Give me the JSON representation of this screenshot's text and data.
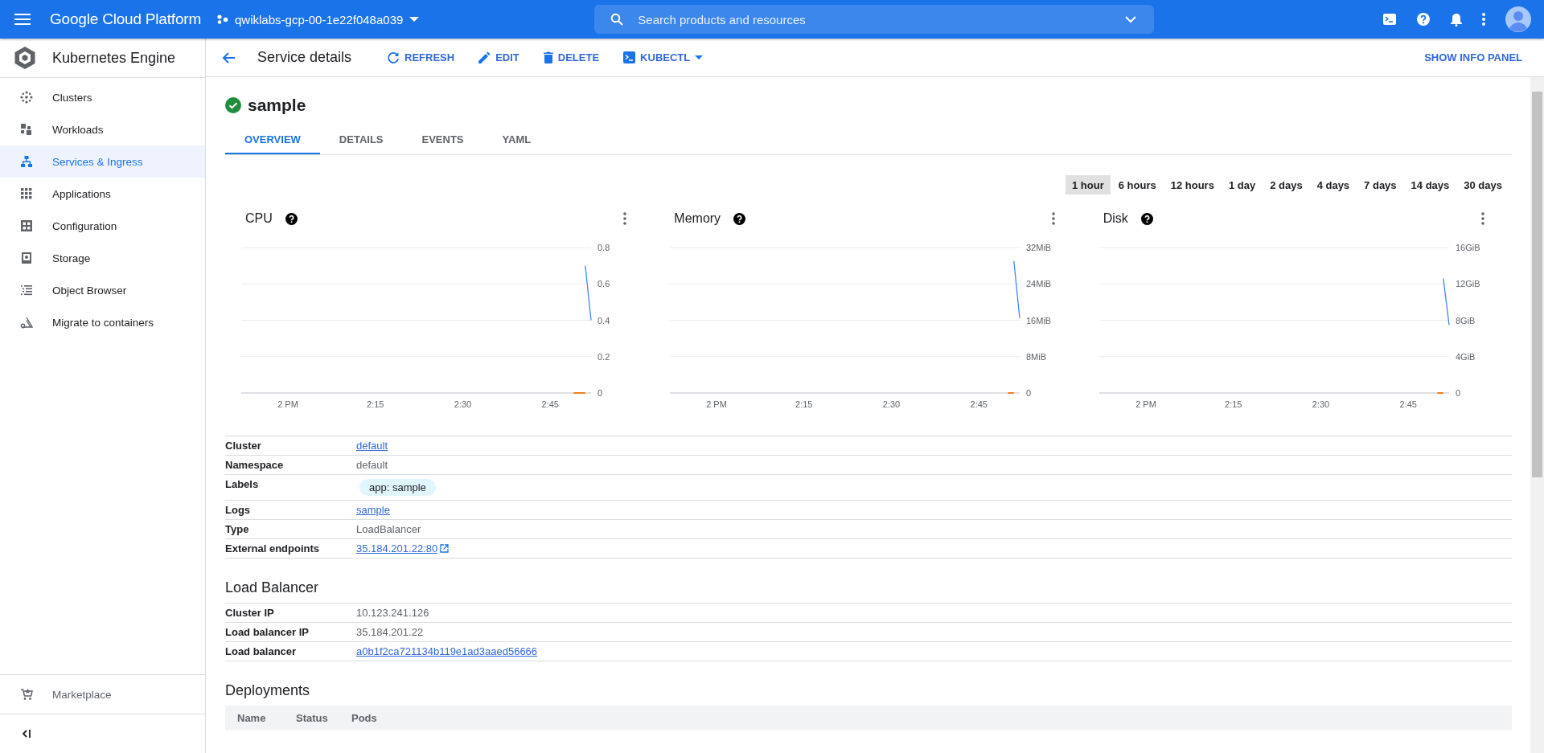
{
  "topbar": {
    "product": "Google Cloud Platform",
    "project": "qwiklabs-gcp-00-1e22f048a039",
    "search": {
      "placeholder": "Search products and resources"
    }
  },
  "sidebar": {
    "title": "Kubernetes Engine",
    "items": [
      {
        "label": "Clusters",
        "kind": "clusters",
        "selected": false
      },
      {
        "label": "Workloads",
        "kind": "workloads",
        "selected": false
      },
      {
        "label": "Services & Ingress",
        "kind": "services",
        "selected": true
      },
      {
        "label": "Applications",
        "kind": "applications",
        "selected": false
      },
      {
        "label": "Configuration",
        "kind": "configuration",
        "selected": false
      },
      {
        "label": "Storage",
        "kind": "storage",
        "selected": false
      },
      {
        "label": "Object Browser",
        "kind": "browser",
        "selected": false
      },
      {
        "label": "Migrate to containers",
        "kind": "migrate",
        "selected": false
      }
    ],
    "footer": {
      "label": "Marketplace"
    }
  },
  "header": {
    "title": "Service details",
    "actions": [
      {
        "label": "REFRESH",
        "kind": "refresh"
      },
      {
        "label": "EDIT",
        "kind": "edit"
      },
      {
        "label": "DELETE",
        "kind": "delete"
      },
      {
        "label": "KUBECTL",
        "kind": "kubectl"
      }
    ],
    "info_panel": "SHOW INFO PANEL"
  },
  "service": {
    "name": "sample",
    "healthy": true
  },
  "tabs": [
    {
      "label": "OVERVIEW",
      "selected": true
    },
    {
      "label": "DETAILS",
      "selected": false
    },
    {
      "label": "EVENTS",
      "selected": false
    },
    {
      "label": "YAML",
      "selected": false
    }
  ],
  "time_ranges": [
    {
      "label": "1 hour",
      "selected": true
    },
    {
      "label": "6 hours",
      "selected": false
    },
    {
      "label": "12 hours",
      "selected": false
    },
    {
      "label": "1 day",
      "selected": false
    },
    {
      "label": "2 days",
      "selected": false
    },
    {
      "label": "4 days",
      "selected": false
    },
    {
      "label": "7 days",
      "selected": false
    },
    {
      "label": "14 days",
      "selected": false
    },
    {
      "label": "30 days",
      "selected": false
    }
  ],
  "charts": [
    {
      "title": "CPU",
      "chart_data": {
        "type": "line",
        "grid": true,
        "categories": [
          null,
          null,
          null,
          null,
          null,
          null,
          null,
          null,
          "2 PM",
          null,
          null,
          null,
          null,
          null,
          null,
          null,
          null,
          null,
          null,
          null,
          null,
          null,
          null,
          "2:15",
          null,
          null,
          null,
          null,
          null,
          null,
          null,
          null,
          null,
          null,
          null,
          null,
          null,
          null,
          "2:30",
          null,
          null,
          null,
          null,
          null,
          null,
          null,
          null,
          null,
          null,
          null,
          null,
          null,
          null,
          "2:45",
          null,
          null,
          null,
          null,
          null,
          null,
          null
        ],
        "ylim": [
          0,
          0.8
        ],
        "yticks": [
          0,
          0.2,
          0.4,
          0.6,
          0.8
        ],
        "series": [
          {
            "color": "#4285f4",
            "values": [
              null,
              null,
              null,
              null,
              null,
              null,
              null,
              null,
              null,
              null,
              null,
              null,
              null,
              null,
              null,
              null,
              null,
              null,
              null,
              null,
              null,
              null,
              null,
              null,
              null,
              null,
              null,
              null,
              null,
              null,
              null,
              null,
              null,
              null,
              null,
              null,
              null,
              null,
              null,
              null,
              null,
              null,
              null,
              null,
              null,
              null,
              null,
              null,
              null,
              null,
              null,
              null,
              null,
              null,
              null,
              null,
              null,
              null,
              null,
              0.7,
              0.4
            ]
          },
          {
            "color": "#fa7b17",
            "values": [
              null,
              null,
              null,
              null,
              null,
              null,
              null,
              null,
              null,
              null,
              null,
              null,
              null,
              null,
              null,
              null,
              null,
              null,
              null,
              null,
              null,
              null,
              null,
              null,
              null,
              null,
              null,
              null,
              null,
              null,
              null,
              null,
              null,
              null,
              null,
              null,
              null,
              null,
              null,
              null,
              null,
              null,
              null,
              null,
              null,
              null,
              null,
              null,
              null,
              null,
              null,
              null,
              null,
              null,
              null,
              null,
              null,
              0,
              0,
              0,
              null
            ]
          }
        ]
      }
    },
    {
      "title": "Memory",
      "chart_data": {
        "type": "line",
        "grid": true,
        "categories": [
          null,
          null,
          null,
          null,
          null,
          null,
          null,
          null,
          "2 PM",
          null,
          null,
          null,
          null,
          null,
          null,
          null,
          null,
          null,
          null,
          null,
          null,
          null,
          null,
          "2:15",
          null,
          null,
          null,
          null,
          null,
          null,
          null,
          null,
          null,
          null,
          null,
          null,
          null,
          null,
          "2:30",
          null,
          null,
          null,
          null,
          null,
          null,
          null,
          null,
          null,
          null,
          null,
          null,
          null,
          null,
          "2:45",
          null,
          null,
          null,
          null,
          null,
          null,
          null
        ],
        "ylim": [
          0,
          32
        ],
        "yticks": [
          {
            "value": 0,
            "label": "0"
          },
          {
            "value": 8,
            "label": "8MiB"
          },
          {
            "value": 16,
            "label": "16MiB"
          },
          {
            "value": 24,
            "label": "24MiB"
          },
          {
            "value": 32,
            "label": "32MiB"
          }
        ],
        "series": [
          {
            "color": "#4285f4",
            "values": [
              null,
              null,
              null,
              null,
              null,
              null,
              null,
              null,
              null,
              null,
              null,
              null,
              null,
              null,
              null,
              null,
              null,
              null,
              null,
              null,
              null,
              null,
              null,
              null,
              null,
              null,
              null,
              null,
              null,
              null,
              null,
              null,
              null,
              null,
              null,
              null,
              null,
              null,
              null,
              null,
              null,
              null,
              null,
              null,
              null,
              null,
              null,
              null,
              null,
              null,
              null,
              null,
              null,
              null,
              null,
              null,
              null,
              null,
              null,
              29,
              16.5
            ]
          },
          {
            "color": "#fa7b17",
            "values": [
              null,
              null,
              null,
              null,
              null,
              null,
              null,
              null,
              null,
              null,
              null,
              null,
              null,
              null,
              null,
              null,
              null,
              null,
              null,
              null,
              null,
              null,
              null,
              null,
              null,
              null,
              null,
              null,
              null,
              null,
              null,
              null,
              null,
              null,
              null,
              null,
              null,
              null,
              null,
              null,
              null,
              null,
              null,
              null,
              null,
              null,
              null,
              null,
              null,
              null,
              null,
              null,
              null,
              null,
              null,
              null,
              null,
              null,
              0,
              0,
              null
            ]
          }
        ]
      }
    },
    {
      "title": "Disk",
      "chart_data": {
        "type": "line",
        "grid": true,
        "categories": [
          null,
          null,
          null,
          null,
          null,
          null,
          null,
          null,
          "2 PM",
          null,
          null,
          null,
          null,
          null,
          null,
          null,
          null,
          null,
          null,
          null,
          null,
          null,
          null,
          "2:15",
          null,
          null,
          null,
          null,
          null,
          null,
          null,
          null,
          null,
          null,
          null,
          null,
          null,
          null,
          "2:30",
          null,
          null,
          null,
          null,
          null,
          null,
          null,
          null,
          null,
          null,
          null,
          null,
          null,
          null,
          "2:45",
          null,
          null,
          null,
          null,
          null,
          null,
          null
        ],
        "ylim": [
          0,
          16
        ],
        "yticks": [
          {
            "value": 0,
            "label": "0"
          },
          {
            "value": 4,
            "label": "4GiB"
          },
          {
            "value": 8,
            "label": "8GiB"
          },
          {
            "value": 12,
            "label": "12GiB"
          },
          {
            "value": 16,
            "label": "16GiB"
          }
        ],
        "series": [
          {
            "color": "#4285f4",
            "values": [
              null,
              null,
              null,
              null,
              null,
              null,
              null,
              null,
              null,
              null,
              null,
              null,
              null,
              null,
              null,
              null,
              null,
              null,
              null,
              null,
              null,
              null,
              null,
              null,
              null,
              null,
              null,
              null,
              null,
              null,
              null,
              null,
              null,
              null,
              null,
              null,
              null,
              null,
              null,
              null,
              null,
              null,
              null,
              null,
              null,
              null,
              null,
              null,
              null,
              null,
              null,
              null,
              null,
              null,
              null,
              null,
              null,
              null,
              null,
              12.6,
              7.5
            ]
          },
          {
            "color": "#fa7b17",
            "values": [
              null,
              null,
              null,
              null,
              null,
              null,
              null,
              null,
              null,
              null,
              null,
              null,
              null,
              null,
              null,
              null,
              null,
              null,
              null,
              null,
              null,
              null,
              null,
              null,
              null,
              null,
              null,
              null,
              null,
              null,
              null,
              null,
              null,
              null,
              null,
              null,
              null,
              null,
              null,
              null,
              null,
              null,
              null,
              null,
              null,
              null,
              null,
              null,
              null,
              null,
              null,
              null,
              null,
              null,
              null,
              null,
              null,
              null,
              0,
              0,
              null
            ]
          }
        ]
      }
    }
  ],
  "details": [
    {
      "label": "Cluster",
      "value": "default",
      "kind": "link"
    },
    {
      "label": "Namespace",
      "value": "default",
      "kind": "text"
    },
    {
      "label": "Labels",
      "value": "app: sample",
      "kind": "chip"
    },
    {
      "label": "Logs",
      "value": "sample",
      "kind": "link"
    },
    {
      "label": "Type",
      "value": "LoadBalancer",
      "kind": "text"
    },
    {
      "label": "External endpoints",
      "value": "35.184.201.22:80",
      "kind": "external"
    }
  ],
  "load_balancer": {
    "title": "Load Balancer",
    "rows": [
      {
        "label": "Cluster IP",
        "value": "10.123.241.126",
        "kind": "text"
      },
      {
        "label": "Load balancer IP",
        "value": "35.184.201.22",
        "kind": "text"
      },
      {
        "label": "Load balancer",
        "value": "a0b1f2ca721134b119e1ad3aaed56666",
        "kind": "link"
      }
    ]
  },
  "deployments": {
    "title": "Deployments",
    "columns": [
      "Name",
      "Status",
      "Pods"
    ]
  }
}
